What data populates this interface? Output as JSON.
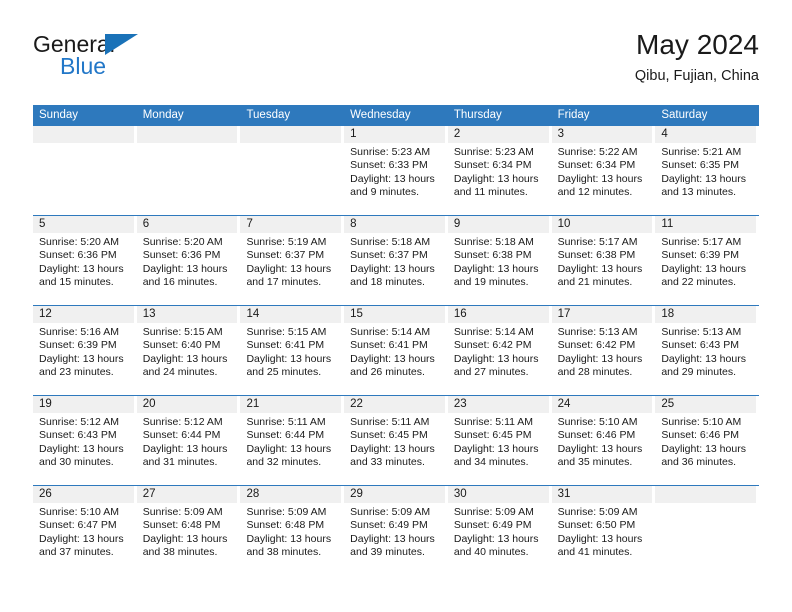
{
  "logo": {
    "line1": "General",
    "line2": "Blue",
    "triangle_color": "#1a72b8",
    "text_color": "#2277c8"
  },
  "header": {
    "title": "May 2024",
    "location": "Qibu, Fujian, China"
  },
  "theme": {
    "header_bg": "#2e79bd",
    "header_text": "#ffffff",
    "daynum_bg": "#f0f0f0",
    "cell_bg": "#ffffff",
    "rule": "#2e79bd"
  },
  "weekdays": [
    "Sunday",
    "Monday",
    "Tuesday",
    "Wednesday",
    "Thursday",
    "Friday",
    "Saturday"
  ],
  "labels": {
    "sunrise": "Sunrise:",
    "sunset": "Sunset:",
    "daylight": "Daylight:"
  },
  "weeks": [
    [
      {
        "day": "",
        "empty": true
      },
      {
        "day": "",
        "empty": true
      },
      {
        "day": "",
        "empty": true
      },
      {
        "day": "1",
        "sunrise": "Sunrise: 5:23 AM",
        "sunset": "Sunset: 6:33 PM",
        "daylight1": "Daylight: 13 hours",
        "daylight2": "and 9 minutes."
      },
      {
        "day": "2",
        "sunrise": "Sunrise: 5:23 AM",
        "sunset": "Sunset: 6:34 PM",
        "daylight1": "Daylight: 13 hours",
        "daylight2": "and 11 minutes."
      },
      {
        "day": "3",
        "sunrise": "Sunrise: 5:22 AM",
        "sunset": "Sunset: 6:34 PM",
        "daylight1": "Daylight: 13 hours",
        "daylight2": "and 12 minutes."
      },
      {
        "day": "4",
        "sunrise": "Sunrise: 5:21 AM",
        "sunset": "Sunset: 6:35 PM",
        "daylight1": "Daylight: 13 hours",
        "daylight2": "and 13 minutes."
      }
    ],
    [
      {
        "day": "5",
        "sunrise": "Sunrise: 5:20 AM",
        "sunset": "Sunset: 6:36 PM",
        "daylight1": "Daylight: 13 hours",
        "daylight2": "and 15 minutes."
      },
      {
        "day": "6",
        "sunrise": "Sunrise: 5:20 AM",
        "sunset": "Sunset: 6:36 PM",
        "daylight1": "Daylight: 13 hours",
        "daylight2": "and 16 minutes."
      },
      {
        "day": "7",
        "sunrise": "Sunrise: 5:19 AM",
        "sunset": "Sunset: 6:37 PM",
        "daylight1": "Daylight: 13 hours",
        "daylight2": "and 17 minutes."
      },
      {
        "day": "8",
        "sunrise": "Sunrise: 5:18 AM",
        "sunset": "Sunset: 6:37 PM",
        "daylight1": "Daylight: 13 hours",
        "daylight2": "and 18 minutes."
      },
      {
        "day": "9",
        "sunrise": "Sunrise: 5:18 AM",
        "sunset": "Sunset: 6:38 PM",
        "daylight1": "Daylight: 13 hours",
        "daylight2": "and 19 minutes."
      },
      {
        "day": "10",
        "sunrise": "Sunrise: 5:17 AM",
        "sunset": "Sunset: 6:38 PM",
        "daylight1": "Daylight: 13 hours",
        "daylight2": "and 21 minutes."
      },
      {
        "day": "11",
        "sunrise": "Sunrise: 5:17 AM",
        "sunset": "Sunset: 6:39 PM",
        "daylight1": "Daylight: 13 hours",
        "daylight2": "and 22 minutes."
      }
    ],
    [
      {
        "day": "12",
        "sunrise": "Sunrise: 5:16 AM",
        "sunset": "Sunset: 6:39 PM",
        "daylight1": "Daylight: 13 hours",
        "daylight2": "and 23 minutes."
      },
      {
        "day": "13",
        "sunrise": "Sunrise: 5:15 AM",
        "sunset": "Sunset: 6:40 PM",
        "daylight1": "Daylight: 13 hours",
        "daylight2": "and 24 minutes."
      },
      {
        "day": "14",
        "sunrise": "Sunrise: 5:15 AM",
        "sunset": "Sunset: 6:41 PM",
        "daylight1": "Daylight: 13 hours",
        "daylight2": "and 25 minutes."
      },
      {
        "day": "15",
        "sunrise": "Sunrise: 5:14 AM",
        "sunset": "Sunset: 6:41 PM",
        "daylight1": "Daylight: 13 hours",
        "daylight2": "and 26 minutes."
      },
      {
        "day": "16",
        "sunrise": "Sunrise: 5:14 AM",
        "sunset": "Sunset: 6:42 PM",
        "daylight1": "Daylight: 13 hours",
        "daylight2": "and 27 minutes."
      },
      {
        "day": "17",
        "sunrise": "Sunrise: 5:13 AM",
        "sunset": "Sunset: 6:42 PM",
        "daylight1": "Daylight: 13 hours",
        "daylight2": "and 28 minutes."
      },
      {
        "day": "18",
        "sunrise": "Sunrise: 5:13 AM",
        "sunset": "Sunset: 6:43 PM",
        "daylight1": "Daylight: 13 hours",
        "daylight2": "and 29 minutes."
      }
    ],
    [
      {
        "day": "19",
        "sunrise": "Sunrise: 5:12 AM",
        "sunset": "Sunset: 6:43 PM",
        "daylight1": "Daylight: 13 hours",
        "daylight2": "and 30 minutes."
      },
      {
        "day": "20",
        "sunrise": "Sunrise: 5:12 AM",
        "sunset": "Sunset: 6:44 PM",
        "daylight1": "Daylight: 13 hours",
        "daylight2": "and 31 minutes."
      },
      {
        "day": "21",
        "sunrise": "Sunrise: 5:11 AM",
        "sunset": "Sunset: 6:44 PM",
        "daylight1": "Daylight: 13 hours",
        "daylight2": "and 32 minutes."
      },
      {
        "day": "22",
        "sunrise": "Sunrise: 5:11 AM",
        "sunset": "Sunset: 6:45 PM",
        "daylight1": "Daylight: 13 hours",
        "daylight2": "and 33 minutes."
      },
      {
        "day": "23",
        "sunrise": "Sunrise: 5:11 AM",
        "sunset": "Sunset: 6:45 PM",
        "daylight1": "Daylight: 13 hours",
        "daylight2": "and 34 minutes."
      },
      {
        "day": "24",
        "sunrise": "Sunrise: 5:10 AM",
        "sunset": "Sunset: 6:46 PM",
        "daylight1": "Daylight: 13 hours",
        "daylight2": "and 35 minutes."
      },
      {
        "day": "25",
        "sunrise": "Sunrise: 5:10 AM",
        "sunset": "Sunset: 6:46 PM",
        "daylight1": "Daylight: 13 hours",
        "daylight2": "and 36 minutes."
      }
    ],
    [
      {
        "day": "26",
        "sunrise": "Sunrise: 5:10 AM",
        "sunset": "Sunset: 6:47 PM",
        "daylight1": "Daylight: 13 hours",
        "daylight2": "and 37 minutes."
      },
      {
        "day": "27",
        "sunrise": "Sunrise: 5:09 AM",
        "sunset": "Sunset: 6:48 PM",
        "daylight1": "Daylight: 13 hours",
        "daylight2": "and 38 minutes."
      },
      {
        "day": "28",
        "sunrise": "Sunrise: 5:09 AM",
        "sunset": "Sunset: 6:48 PM",
        "daylight1": "Daylight: 13 hours",
        "daylight2": "and 38 minutes."
      },
      {
        "day": "29",
        "sunrise": "Sunrise: 5:09 AM",
        "sunset": "Sunset: 6:49 PM",
        "daylight1": "Daylight: 13 hours",
        "daylight2": "and 39 minutes."
      },
      {
        "day": "30",
        "sunrise": "Sunrise: 5:09 AM",
        "sunset": "Sunset: 6:49 PM",
        "daylight1": "Daylight: 13 hours",
        "daylight2": "and 40 minutes."
      },
      {
        "day": "31",
        "sunrise": "Sunrise: 5:09 AM",
        "sunset": "Sunset: 6:50 PM",
        "daylight1": "Daylight: 13 hours",
        "daylight2": "and 41 minutes."
      },
      {
        "day": "",
        "empty": true
      }
    ]
  ]
}
